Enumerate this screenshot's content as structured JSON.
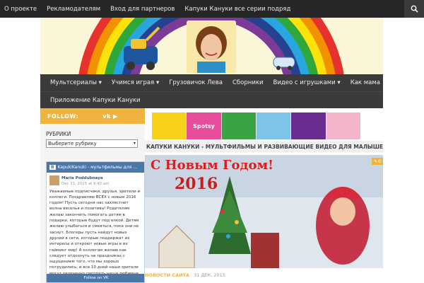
{
  "topnav": {
    "items": [
      "О проекте",
      "Рекламодателям",
      "Вход для партнеров",
      "Капуки Кануки все серии подряд"
    ]
  },
  "mainnav": {
    "row1": [
      "Мультсериалы ▾",
      "Учимся играя ▾",
      "Грузовичок Лева",
      "Сборники",
      "Видео с игрушками ▾",
      "Как мама"
    ],
    "row2": [
      "Приложение Капуки Кануки"
    ]
  },
  "sidebar": {
    "follow_label": "FOLLOW:",
    "social": "vk ▶",
    "rubrics_heading": "РУБРИКИ",
    "rubrics_select": "Выберите рубрику"
  },
  "vk_widget": {
    "header": "KapukiKanuki - мультфильмы для ...",
    "author": "Maria Poddubnaya",
    "date": "Dec 31, 2015 at 9:40 am",
    "text": "Уважаемые подписчики, друзья, зрители и коллеги. Поздравляю ВСЕХ с новым 2016 годом! Пусть сегодня нас захлестнет волна веселья и позитива! Родителям желаю закончить помогать детям в подарки, которые будут под елкой. Детям желаю улыбаться и смеяться, пока они не заснут. Блогеры пусть найдут новых друзей в сети, которые поддержат их интересы и откроют новые игры в их гейминг мир! А коллегам желаю как следует отдохнуть на праздниках с ощущением того, что мы хорошо потрудились, и все 10 дней наши зрители могут увлеченно смотреть наши любимые ролики!",
    "footer": "Follow on VK"
  },
  "main": {
    "ticker": "КАПУКИ КАНУКИ - МУЛЬТФИЛЬМЫ И РАЗВИВАЮЩИЕ ВИДЕО ДЛЯ МАЛЫШЕЙ",
    "photo_title": "С Новым Годом!",
    "photo_year": "2016",
    "comment_count": "0",
    "post_category": "НОВОСТИ САЙТА",
    "post_date": "31 ДЕК, 2015",
    "ad_text": "Spotsy"
  }
}
